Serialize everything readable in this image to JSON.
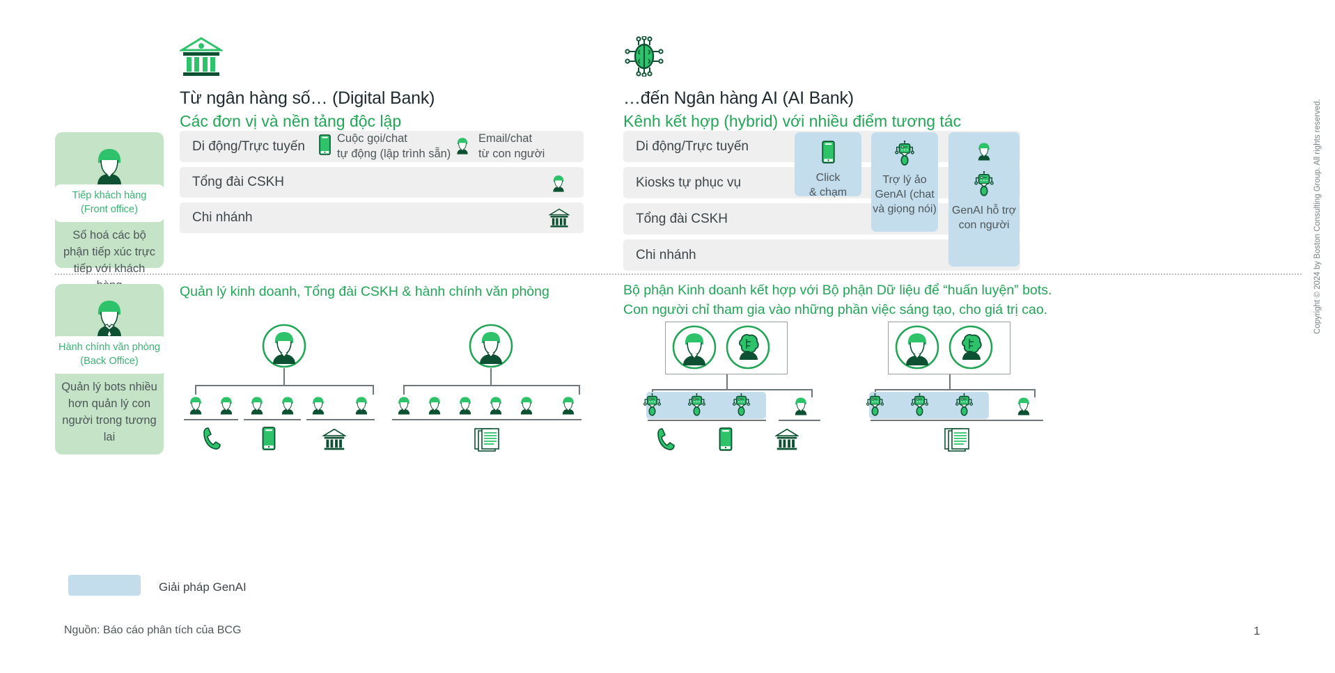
{
  "columns": {
    "left": {
      "icon": "bank-building-icon",
      "title": "Từ ngân hàng số… (Digital Bank)",
      "subtitle": "Các đơn vị và nền tảng độc lập"
    },
    "right": {
      "icon": "ai-brain-chip-icon",
      "title": "…đến Ngân hàng AI (AI Bank)",
      "subtitle": "Kênh kết hợp (hybrid) với nhiều điểm tương tác"
    }
  },
  "side_boxes": [
    {
      "avatar_icon": "person-avatar-icon",
      "pill_line1": "Tiếp khách hàng",
      "pill_line2": "(Front office)",
      "description": "Số hoá các bộ phận tiếp xúc trực tiếp với khách hàng"
    },
    {
      "avatar_icon": "person-avatar-tie-icon",
      "pill_line1": "Hành chính văn phòng",
      "pill_line2": "(Back Office)",
      "description": "Quản lý bots nhiều hơn quản lý con người trong tương lai"
    }
  ],
  "digital_bank": {
    "rows": [
      {
        "label": "Di động/Trực tuyến"
      },
      {
        "label": "Tổng đài CSKH"
      },
      {
        "label": "Chi nhánh"
      }
    ],
    "inline_items": [
      {
        "icon": "mobile-phone-icon",
        "line1": "Cuộc gọi/chat",
        "line2": "tự động (lập trình sẵn)"
      },
      {
        "icon": "person-avatar-icon",
        "line1": "Email/chat",
        "line2": "từ con người"
      }
    ],
    "row_icons": [
      {
        "icon": "person-avatar-icon",
        "row": "Tổng đài CSKH"
      },
      {
        "icon": "bank-building-icon",
        "row": "Chi nhánh"
      }
    ]
  },
  "ai_bank": {
    "rows": [
      {
        "label": "Di động/Trực tuyến"
      },
      {
        "label": "Kiosks tự phục vụ"
      },
      {
        "label": "Tổng đài CSKH"
      },
      {
        "label": "Chi nhánh"
      }
    ],
    "genai_boxes": [
      {
        "icon": "mobile-phone-icon",
        "cap_line1": "Click",
        "cap_line2": "& chạm"
      },
      {
        "icon": "robot-bot-icon",
        "cap_line1": "Trợ lý ảo",
        "cap_line2": "GenAI (chat",
        "cap_line3": "và giọng nói)"
      },
      {
        "icon_top": "person-avatar-icon",
        "icon_bottom": "robot-bot-icon",
        "cap_line1": "GenAI hỗ trợ",
        "cap_line2": "con người"
      }
    ]
  },
  "back_office": {
    "left_heading": "Quản lý kinh doanh, Tổng đài CSKH & hành chính văn phòng",
    "right_heading_line1": "Bộ phận Kinh doanh kết hợp với Bộ phận Dữ liệu để “huấn luyện” bots.",
    "right_heading_line2": "Con người chỉ tham gia vào những phần việc sáng tạo, cho giá trị cao.",
    "left_org_charts": [
      {
        "manager_icon": "person-circle-icon",
        "reports": 6,
        "report_icon": "person-avatar-icon",
        "channel_icons": [
          "telephone-icon",
          "mobile-phone-icon",
          "bank-building-icon"
        ]
      },
      {
        "manager_icon": "person-circle-icon",
        "reports": 6,
        "report_icon": "person-avatar-icon",
        "channel_icons": [
          "documents-icon"
        ]
      }
    ],
    "right_org_charts": [
      {
        "manager_icons": [
          "person-circle-icon",
          "ai-brain-circle-icon"
        ],
        "bot_reports": 3,
        "bot_icon": "robot-bot-icon",
        "human_reports": 1,
        "human_icon": "person-avatar-icon",
        "channel_icons": [
          "telephone-icon",
          "mobile-phone-icon",
          "bank-building-icon"
        ]
      },
      {
        "manager_icons": [
          "person-circle-icon",
          "ai-brain-circle-icon"
        ],
        "bot_reports": 3,
        "bot_icon": "robot-bot-icon",
        "human_reports": 1,
        "human_icon": "person-avatar-icon",
        "channel_icons": [
          "documents-icon"
        ]
      }
    ]
  },
  "legend": {
    "swatch_color": "#c3dded",
    "label": "Giải pháp GenAI"
  },
  "footer": {
    "source": "Nguồn: Báo cáo phân tích của BCG",
    "page_number": "1",
    "copyright": "Copyright © 2024 by Boston Consulting Group.  All  rights reserved."
  },
  "colors": {
    "brand_green": "#22a556",
    "icon_green": "#2ec26b",
    "dark_green": "#0d5132",
    "row_gray": "#efefef",
    "side_green": "#c5e3c7",
    "genai_blue": "#c3dded"
  }
}
